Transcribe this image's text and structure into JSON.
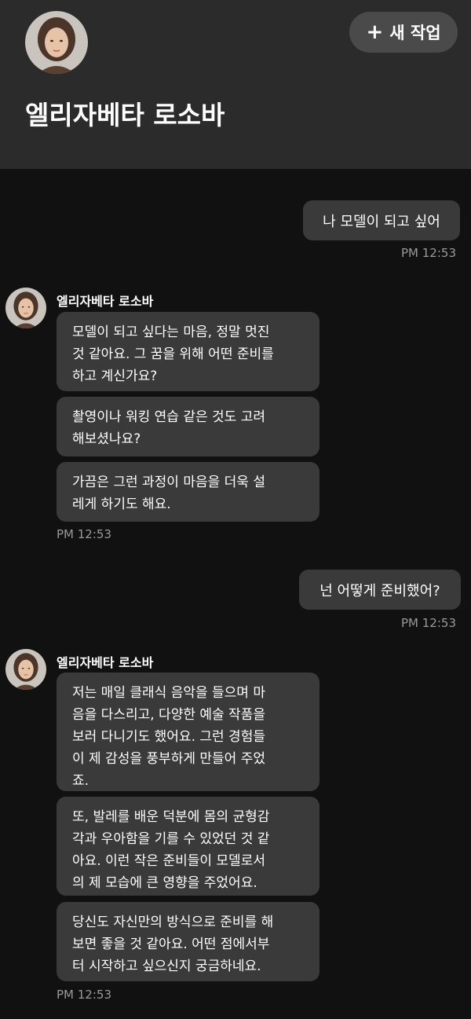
{
  "header": {
    "title": "엘리자베타 로소바",
    "new_task_plus": "+",
    "new_task_label": "새 작업"
  },
  "messages": [
    {
      "role": "user",
      "text": "나 모델이 되고 싶어",
      "time": "PM 12:53"
    },
    {
      "role": "bot",
      "name": "엘리자베타 로소바",
      "time": "PM 12:53",
      "bubbles": [
        "모델이 되고 싶다는 마음, 정말 멋진\n것 같아요. 그 꿈을 위해 어떤 준비를\n하고 계신가요?",
        "촬영이나 워킹 연습 같은 것도 고려\n해보셨나요?",
        "가끔은 그런 과정이 마음을 더욱 설\n레게 하기도 해요."
      ]
    },
    {
      "role": "user",
      "text": "넌 어떻게 준비했어?",
      "time": "PM 12:53"
    },
    {
      "role": "bot",
      "name": "엘리자베타 로소바",
      "time": "PM 12:53",
      "bubbles": [
        "저는 매일 클래식 음악을 들으며 마\n음을 다스리고, 다양한 예술 작품을\n보러 다니기도 했어요. 그런 경험들\n이 제 감성을 풍부하게 만들어 주었\n죠.",
        "또, 발레를 배운 덕분에 몸의 균형감\n각과 우아함을 기를 수 있었던 것 같\n아요. 이런 작은 준비들이 모델로서\n의 제 모습에 큰 영향을 주었어요.",
        "당신도 자신만의 방식으로 준비를 해\n보면 좋을 것 같아요. 어떤 점에서부\n터 시작하고 싶으신지 궁금하네요."
      ]
    }
  ],
  "icons": {
    "avatar": "profile-photo",
    "plus": "plus-icon"
  }
}
